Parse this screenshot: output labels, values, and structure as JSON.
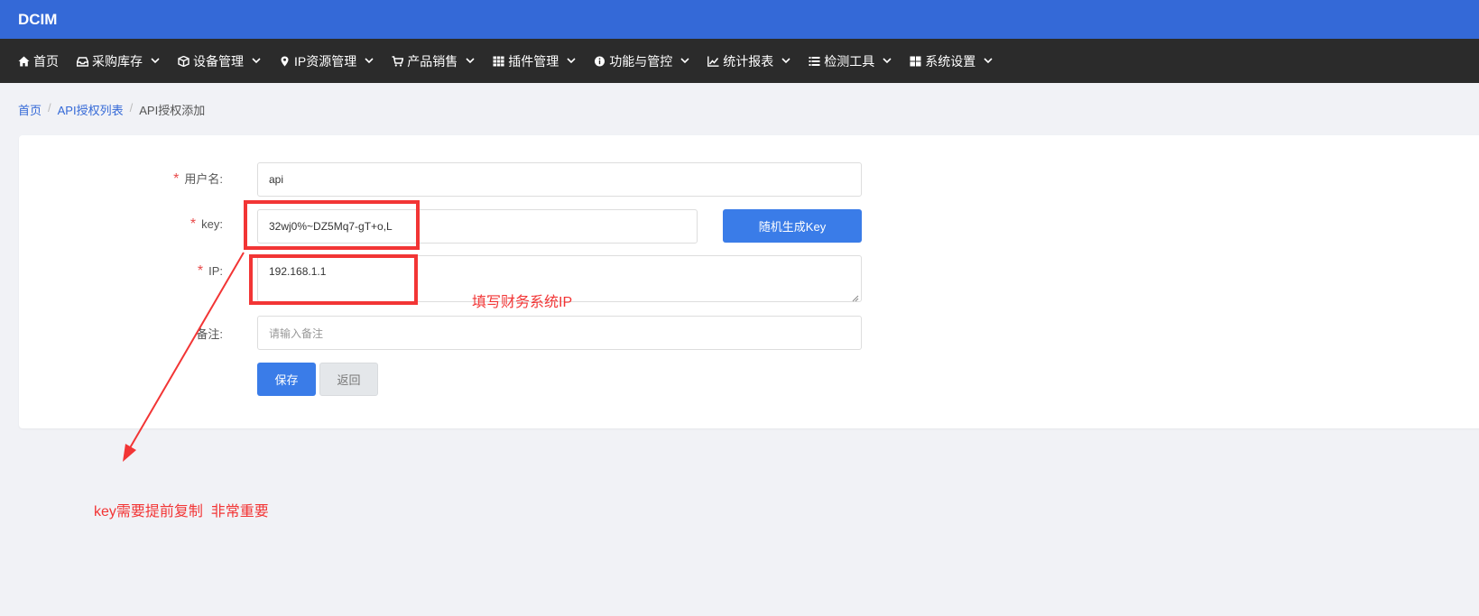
{
  "app": {
    "brand": "DCIM"
  },
  "nav": [
    {
      "label": "首页",
      "icon": "home-icon",
      "has_caret": false
    },
    {
      "label": "采购库存",
      "icon": "inbox-icon",
      "has_caret": true
    },
    {
      "label": "设备管理",
      "icon": "cube-icon",
      "has_caret": true
    },
    {
      "label": "IP资源管理",
      "icon": "map-marker-icon",
      "has_caret": true
    },
    {
      "label": "产品销售",
      "icon": "cart-icon",
      "has_caret": true
    },
    {
      "label": "插件管理",
      "icon": "grid-icon",
      "has_caret": true
    },
    {
      "label": "功能与管控",
      "icon": "info-circle-icon",
      "has_caret": true
    },
    {
      "label": "统计报表",
      "icon": "line-chart-icon",
      "has_caret": true
    },
    {
      "label": "检测工具",
      "icon": "list-icon",
      "has_caret": true
    },
    {
      "label": "系统设置",
      "icon": "windows-icon",
      "has_caret": true
    }
  ],
  "breadcrumb": {
    "home": "首页",
    "list": "API授权列表",
    "current": "API授权添加",
    "separator": "/"
  },
  "form": {
    "required_mark": "*",
    "username": {
      "label": "用户名:",
      "value": "api"
    },
    "key": {
      "label": "key:",
      "value": "32wj0%~DZ5Mq7-gT+o,L"
    },
    "ip": {
      "label": "IP:",
      "value": "192.168.1.1"
    },
    "remark": {
      "label": "备注:",
      "placeholder": "请输入备注"
    },
    "generate_key_button": "随机生成Key",
    "save_button": "保存",
    "back_button": "返回"
  },
  "annotations": {
    "ip_note": "填写财务系统IP",
    "key_note": "key需要提前复制  非常重要",
    "color": "#f23535"
  },
  "colors": {
    "topbar": "#3469d7",
    "navbar": "#2b2b2b",
    "primary_button": "#3a7ce8"
  }
}
